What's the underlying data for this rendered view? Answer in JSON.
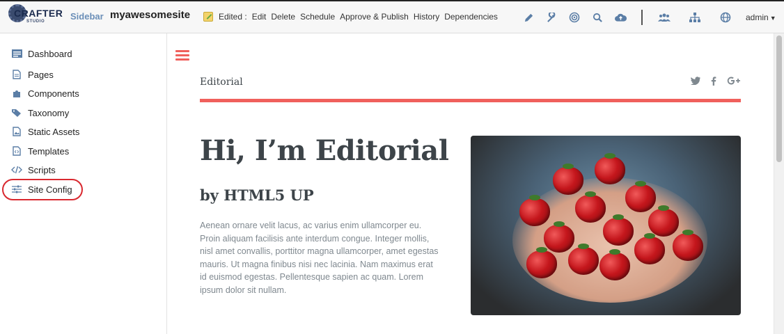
{
  "topbar": {
    "logo_text": "CRAFTER",
    "logo_sub": "STUDIO",
    "sidebar_link": "Sidebar",
    "site_name": "myawesomesite",
    "page_status": "Edited :",
    "actions": [
      "Edit",
      "Delete",
      "Schedule",
      "Approve & Publish",
      "History",
      "Dependencies"
    ],
    "tool_icons": [
      "pencil-icon",
      "wrench-icon",
      "target-icon",
      "search-icon",
      "cloud-upload-icon",
      "users-icon",
      "sitemap-icon",
      "globe-icon"
    ],
    "user_menu": "admin"
  },
  "sidebar": {
    "items": [
      {
        "label": "Dashboard",
        "icon": "dashboard-icon"
      },
      {
        "label": "Pages",
        "icon": "page-icon"
      },
      {
        "label": "Components",
        "icon": "puzzle-icon"
      },
      {
        "label": "Taxonomy",
        "icon": "tags-icon"
      },
      {
        "label": "Static Assets",
        "icon": "image-file-icon"
      },
      {
        "label": "Templates",
        "icon": "code-file-icon"
      },
      {
        "label": "Scripts",
        "icon": "code-icon"
      },
      {
        "label": "Site Config",
        "icon": "sliders-icon"
      }
    ],
    "highlighted": "Site Config"
  },
  "preview": {
    "site_title": "Editorial",
    "social": [
      "twitter-icon",
      "facebook-icon",
      "google-plus-icon"
    ],
    "headline": "Hi, I’m Editorial",
    "subheadline": "by HTML5 UP",
    "body": "Aenean ornare velit lacus, ac varius enim ullamcorper eu. Proin aliquam facilisis ante interdum congue. Integer mollis, nisl amet convallis, porttitor magna ullamcorper, amet egestas mauris. Ut magna finibus nisi nec lacinia. Nam maximus erat id euismod egestas. Pellentesque sapien ac quam. Lorem ipsum dolor sit nullam."
  },
  "colors": {
    "accent": "#f0605c",
    "nav_blue": "#5b7ea6",
    "highlight_ring": "#d9282f"
  }
}
